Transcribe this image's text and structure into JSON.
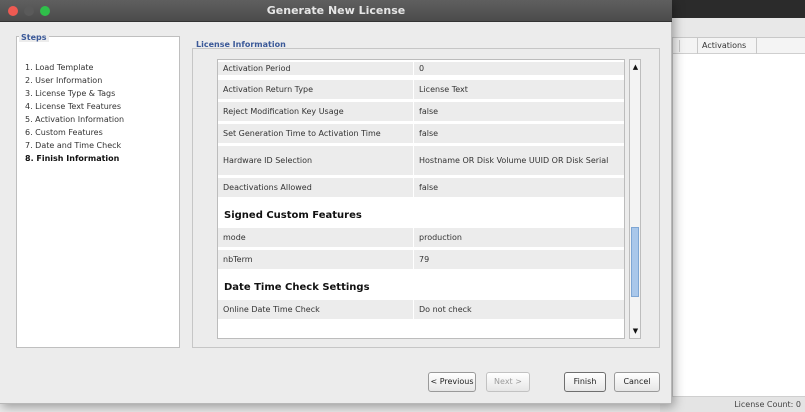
{
  "window": {
    "title": "Generate New License"
  },
  "background_app": {
    "table": {
      "columns": [
        "Activations"
      ]
    },
    "status": {
      "license_count": "License Count: 0"
    }
  },
  "steps": {
    "header": "Steps",
    "items": [
      {
        "label": "1. Load Template",
        "active": false
      },
      {
        "label": "2. User Information",
        "active": false
      },
      {
        "label": "3. License Type & Tags",
        "active": false
      },
      {
        "label": "4. License Text Features",
        "active": false
      },
      {
        "label": "5. Activation Information",
        "active": false
      },
      {
        "label": "6. Custom Features",
        "active": false
      },
      {
        "label": "7. Date and Time Check",
        "active": false
      },
      {
        "label": "8. Finish Information",
        "active": true
      }
    ]
  },
  "license_info": {
    "header": "License Information",
    "rows": [
      {
        "key": "Activation Period",
        "value": "0"
      },
      {
        "key": "Activation Return Type",
        "value": "License Text"
      },
      {
        "key": "Reject Modification Key Usage",
        "value": "false"
      },
      {
        "key": "Set Generation Time to Activation Time",
        "value": "false"
      },
      {
        "key": "Hardware ID Selection",
        "value": "Hostname OR Disk Volume UUID OR Disk Serial"
      },
      {
        "key": "Deactivations Allowed",
        "value": "false"
      }
    ],
    "custom_features": {
      "title": "Signed Custom Features",
      "rows": [
        {
          "key": "mode",
          "value": "production"
        },
        {
          "key": "nbTerm",
          "value": "79"
        }
      ]
    },
    "date_time": {
      "title": "Date Time Check Settings",
      "rows": [
        {
          "key": "Online Date Time Check",
          "value": "Do not check"
        }
      ]
    },
    "scroll_position": 0.85
  },
  "buttons": {
    "previous": "< Previous",
    "next": "Next >",
    "finish": "Finish",
    "cancel": "Cancel"
  },
  "colors": {
    "section_header": "#3b5998",
    "scroll_thumb": "#a9c7ea"
  }
}
